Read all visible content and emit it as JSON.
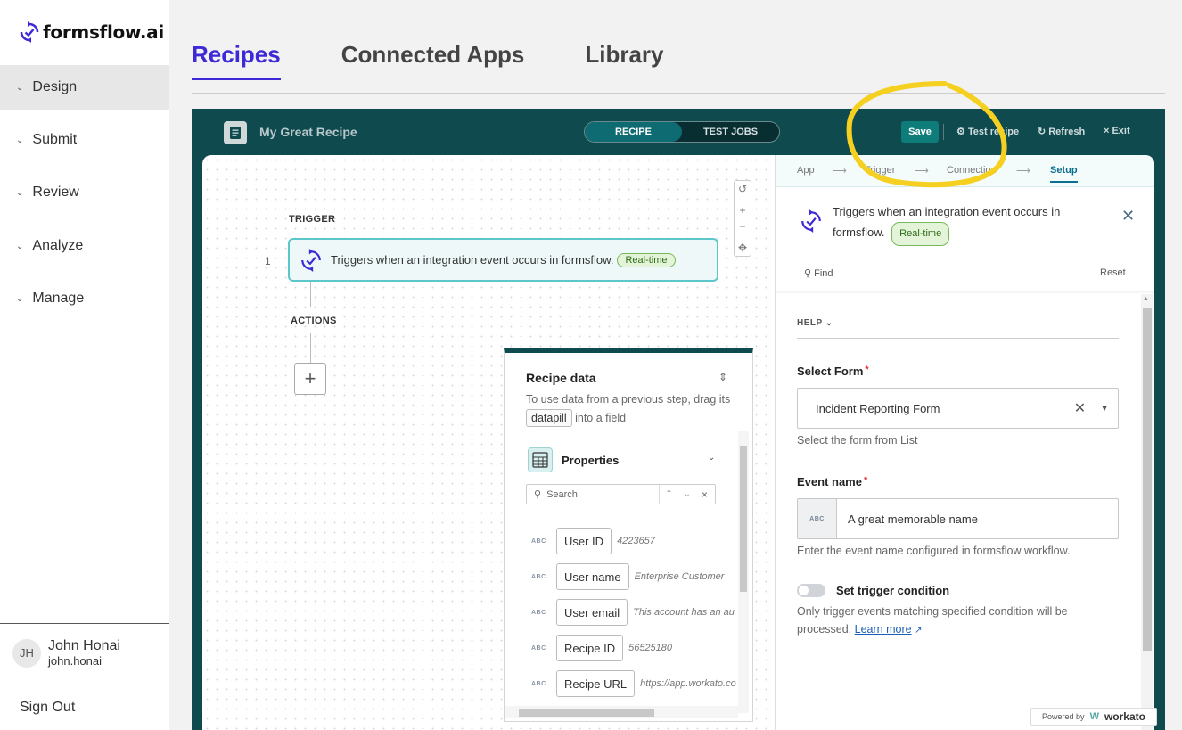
{
  "app": {
    "logo_text": "formsflow.ai"
  },
  "sidebar": {
    "items": [
      {
        "label": "Design"
      },
      {
        "label": "Submit"
      },
      {
        "label": "Review"
      },
      {
        "label": "Analyze"
      },
      {
        "label": "Manage"
      }
    ],
    "user": {
      "initials": "JH",
      "name": "John Honai",
      "username": "john.honai"
    },
    "sign_out": "Sign Out"
  },
  "tabs": [
    {
      "label": "Recipes",
      "active": true
    },
    {
      "label": "Connected Apps",
      "active": false
    },
    {
      "label": "Library",
      "active": false
    }
  ],
  "recipe": {
    "title": "My Great Recipe",
    "mode_toggle": {
      "recipe": "RECIPE",
      "test_jobs": "TEST JOBS",
      "selected": "RECIPE"
    },
    "save": "Save",
    "test_recipe": "Test recipe",
    "refresh": "Refresh",
    "exit": "Exit"
  },
  "canvas": {
    "trigger_label": "TRIGGER",
    "step_number": "1",
    "trigger_text": "Triggers when an integration event occurs in formsflow.",
    "badge": "Real-time",
    "actions_label": "ACTIONS"
  },
  "recipe_data": {
    "title": "Recipe data",
    "desc_before": "To use data from a previous step, drag its",
    "desc_pill": "datapill",
    "desc_after": "into a field",
    "properties_label": "Properties",
    "search_placeholder": "Search",
    "pills": [
      {
        "type": "ABC",
        "label": "User ID",
        "sample": "4223657"
      },
      {
        "type": "ABC",
        "label": "User name",
        "sample": "Enterprise Customer"
      },
      {
        "type": "ABC",
        "label": "User email",
        "sample": "This account has an au"
      },
      {
        "type": "ABC",
        "label": "Recipe ID",
        "sample": "56525180"
      },
      {
        "type": "ABC",
        "label": "Recipe URL",
        "sample": "https://app.workato.co"
      }
    ]
  },
  "panel": {
    "breadcrumbs": [
      "App",
      "Trigger",
      "Connection",
      "Setup"
    ],
    "active_crumb": "Setup",
    "header_line1": "Triggers when an integration event occurs in",
    "header_line2": "formsflow.",
    "badge": "Real-time",
    "find": "Find",
    "reset": "Reset",
    "help": "HELP",
    "select_form_label": "Select Form",
    "select_form_value": "Incident Reporting Form",
    "select_form_hint": "Select the form from List",
    "event_name_label": "Event name",
    "event_name_type": "ABC",
    "event_name_value": "A great memorable name",
    "event_name_hint": "Enter the event name configured in formsflow workflow.",
    "trigger_condition_label": "Set trigger condition",
    "trigger_condition_hint": "Only trigger events matching specified condition will be processed.",
    "learn_more": "Learn more",
    "trigger_condition_on": false
  },
  "powered_by": {
    "prefix": "Powered by",
    "brand": "workato"
  },
  "colors": {
    "brand": "#3d29d6",
    "header": "#0f4a4f",
    "accent": "#0e7d7a",
    "annotation": "#f5d020"
  }
}
